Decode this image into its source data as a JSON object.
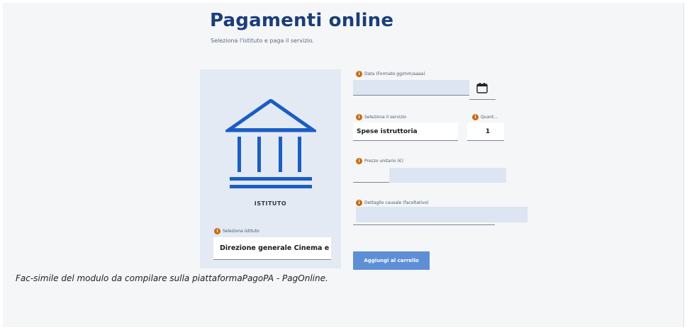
{
  "header": {
    "title": "Pagamenti online",
    "subtitle": "Seleziona l'istituto e paga il servizio."
  },
  "institute": {
    "label": "ISTITUTO",
    "select_label": "Seleziona istituto",
    "selected_value": "Direzione generale Cinema e au"
  },
  "form": {
    "date_label": "Data (Formato gg/mm/aaaa)",
    "date_value": "",
    "service_label": "Seleziona il servizio",
    "service_value": "Spese istruttoria",
    "quantity_label": "Quant...",
    "quantity_value": "1",
    "unit_price_label": "Prezzo unitario (€)",
    "unit_price_value": "",
    "reason_label": "Dettaglio causale (facoltativo)",
    "reason_value": "",
    "add_button": "Aggiungi al carrello"
  },
  "icons": {
    "help": "i",
    "calendar": "calendar-icon",
    "institute": "bank-building-icon"
  },
  "colors": {
    "title": "#1c3d7a",
    "accent": "#1a5ec4",
    "button": "#5e8fd6",
    "help_badge": "#c86d12",
    "panel": "#e3eaf3"
  },
  "caption": "Fac-simile del modulo da compilare sulla piattaformaPagoPA - PagOnline."
}
